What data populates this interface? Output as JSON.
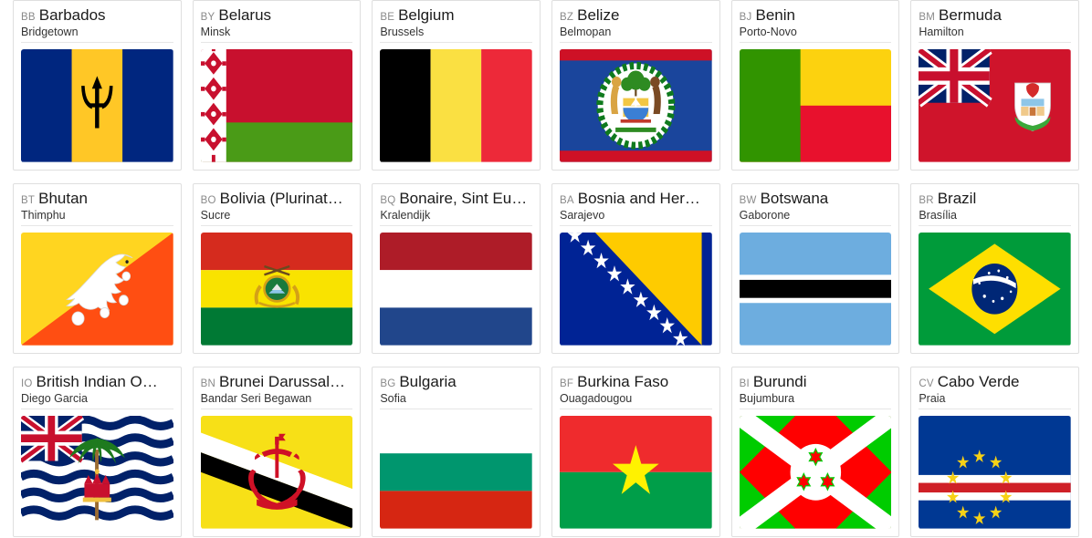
{
  "grid": {
    "columns": 6,
    "cards": [
      {
        "code": "BB",
        "name": "Barbados",
        "capital": "Bridgetown",
        "flag": "barbados-flag"
      },
      {
        "code": "BY",
        "name": "Belarus",
        "capital": "Minsk",
        "flag": "belarus-flag"
      },
      {
        "code": "BE",
        "name": "Belgium",
        "capital": "Brussels",
        "flag": "belgium-flag"
      },
      {
        "code": "BZ",
        "name": "Belize",
        "capital": "Belmopan",
        "flag": "belize-flag"
      },
      {
        "code": "BJ",
        "name": "Benin",
        "capital": "Porto-Novo",
        "flag": "benin-flag"
      },
      {
        "code": "BM",
        "name": "Bermuda",
        "capital": "Hamilton",
        "flag": "bermuda-flag"
      },
      {
        "code": "BT",
        "name": "Bhutan",
        "capital": "Thimphu",
        "flag": "bhutan-flag"
      },
      {
        "code": "BO",
        "name": "Bolivia (Plurinat…",
        "capital": "Sucre",
        "flag": "bolivia-flag"
      },
      {
        "code": "BQ",
        "name": "Bonaire, Sint Eu…",
        "capital": "Kralendijk",
        "flag": "bonaire-flag"
      },
      {
        "code": "BA",
        "name": "Bosnia and Her…",
        "capital": "Sarajevo",
        "flag": "bosnia-and-herzegovina-flag"
      },
      {
        "code": "BW",
        "name": "Botswana",
        "capital": "Gaborone",
        "flag": "botswana-flag"
      },
      {
        "code": "BR",
        "name": "Brazil",
        "capital": "Brasília",
        "flag": "brazil-flag"
      },
      {
        "code": "IO",
        "name": "British Indian O…",
        "capital": "Diego Garcia",
        "flag": "british-indian-ocean-territory-flag"
      },
      {
        "code": "BN",
        "name": "Brunei Darussal…",
        "capital": "Bandar Seri Begawan",
        "flag": "brunei-flag"
      },
      {
        "code": "BG",
        "name": "Bulgaria",
        "capital": "Sofia",
        "flag": "bulgaria-flag"
      },
      {
        "code": "BF",
        "name": "Burkina Faso",
        "capital": "Ouagadougou",
        "flag": "burkina-faso-flag"
      },
      {
        "code": "BI",
        "name": "Burundi",
        "capital": "Bujumbura",
        "flag": "burundi-flag"
      },
      {
        "code": "CV",
        "name": "Cabo Verde",
        "capital": "Praia",
        "flag": "cabo-verde-flag"
      }
    ]
  },
  "colors": {
    "card_border": "#dfdfdf",
    "code_text": "#8a8a8a",
    "name_text": "#1b1b1b",
    "capital_text": "#333333",
    "barbados_blue": "#00267f",
    "barbados_yellow": "#ffc726",
    "belarus_red": "#c8102e",
    "belarus_green": "#4a9b17",
    "belgium_black": "#000000",
    "belgium_yellow": "#fae042",
    "belgium_red": "#ed2939",
    "belize_blue": "#1a459c",
    "belize_red": "#ce1126",
    "benin_green": "#319400",
    "benin_yellow": "#fcd20f",
    "benin_red": "#e8112d",
    "bermuda_red": "#cf142b",
    "bhutan_yellow": "#ffd520",
    "bhutan_orange": "#ff4e12",
    "bolivia_red": "#d52b1e",
    "bolivia_yellow": "#f9e300",
    "bolivia_green": "#007934",
    "bonaire_red": "#ae1c28",
    "bonaire_blue": "#21468b",
    "bosnia_blue": "#002395",
    "bosnia_yellow": "#fecb00",
    "botswana_blue": "#6daddf",
    "botswana_black": "#000000",
    "brazil_green": "#009b3a",
    "brazil_yellow": "#fedf00",
    "brazil_blue": "#002776",
    "biot_blue": "#012169",
    "brunei_yellow": "#f7e017",
    "brunei_red": "#cf1126",
    "bulgaria_white": "#ffffff",
    "bulgaria_green": "#00966e",
    "bulgaria_red": "#d62612",
    "burkina_red": "#ef2b2d",
    "burkina_green": "#009e49",
    "burkina_yellow": "#fff200",
    "burundi_red": "#ff0000",
    "burundi_green": "#00cc00",
    "cabo_blue": "#003893",
    "cabo_red": "#cf2027",
    "cabo_yellow": "#f7d116"
  }
}
